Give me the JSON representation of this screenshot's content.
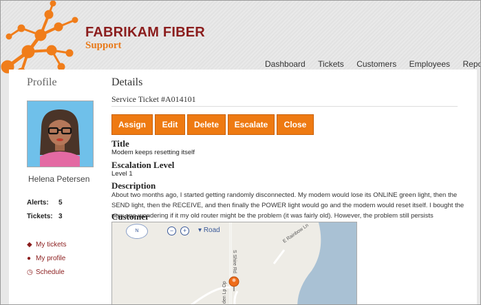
{
  "brand": {
    "name": "FABRIKAM FIBER",
    "sub": "Support"
  },
  "nav": [
    "Dashboard",
    "Tickets",
    "Customers",
    "Employees",
    "Reports"
  ],
  "profile": {
    "heading": "Profile",
    "name": "Helena Petersen",
    "alerts_label": "Alerts:",
    "alerts_value": "5",
    "tickets_label": "Tickets:",
    "tickets_value": "3",
    "links": [
      {
        "label": "My tickets",
        "icon": "tag-icon"
      },
      {
        "label": "My profile",
        "icon": "person-icon"
      },
      {
        "label": "Schedule",
        "icon": "clock-icon"
      }
    ]
  },
  "details": {
    "heading": "Details",
    "ticket": "Service Ticket #A014101",
    "buttons": [
      "Assign",
      "Edit",
      "Delete",
      "Escalate",
      "Close"
    ],
    "title_label": "Title",
    "title_value": "Modem keeps resetting itself",
    "escalation_label": "Escalation Level",
    "escalation_value": "Level 1",
    "description_label": "Description",
    "description_value": "About two months ago, I started getting randomly disconnected. My modem would lose its ONLINE green light, then the SEND light, then the RECEIVE, and then finally the POWER light would go and the modem would reset itself. I bought the new one wondering if it my old router might be the problem (it was fairly old). However, the problem still persists",
    "customer_label": "Customer"
  },
  "map": {
    "compass": "N",
    "view": "Road",
    "streets": [
      "S Shire Rd",
      "E Rainbow Ln",
      "den Lp Op"
    ]
  },
  "colors": {
    "accent": "#ee7a12",
    "brand": "#8b1d1d"
  }
}
